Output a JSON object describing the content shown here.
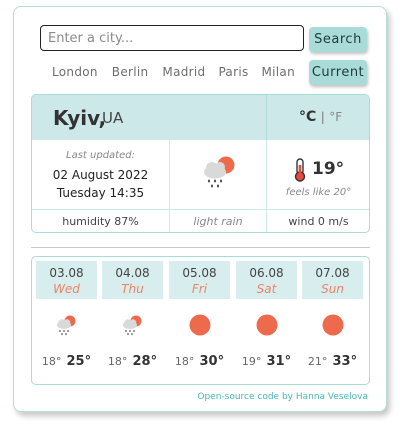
{
  "search": {
    "placeholder": "Enter a city...",
    "value": "",
    "button_label": "Search",
    "current_label": "Current"
  },
  "quick_cities": [
    "London",
    "Berlin",
    "Madrid",
    "Paris",
    "Milan"
  ],
  "current": {
    "city": "Kyiv,",
    "country": "UA",
    "unit_c": "°C",
    "unit_sep": "|",
    "unit_f": "°F",
    "last_updated_label": "Last updated:",
    "date": "02 August 2022",
    "day_time": "Tuesday 14:35",
    "humidity": "humidity 87%",
    "description": "light rain",
    "icon": "sun-cloud-rain-icon",
    "temperature": "19°",
    "feels_like": "feels like 20°",
    "wind": "wind 0 m/s"
  },
  "forecast": [
    {
      "date": "03.08",
      "day": "Wed",
      "icon": "sun-cloud-rain-icon",
      "min": "18°",
      "max": "25°"
    },
    {
      "date": "04.08",
      "day": "Thu",
      "icon": "sun-cloud-rain-icon",
      "min": "18°",
      "max": "28°"
    },
    {
      "date": "05.08",
      "day": "Fri",
      "icon": "sun-icon",
      "min": "18°",
      "max": "30°"
    },
    {
      "date": "06.08",
      "day": "Sat",
      "icon": "sun-icon",
      "min": "19°",
      "max": "31°"
    },
    {
      "date": "07.08",
      "day": "Sun",
      "icon": "sun-icon",
      "min": "21°",
      "max": "33°"
    }
  ],
  "footer": "Open-source code by Hanna Veselova",
  "colors": {
    "accent": "#a9dbd9",
    "header_bg": "#cce8e8",
    "sun": "#ee6a4d",
    "day_name": "#ee8363",
    "footer_link": "#49b7b3"
  }
}
